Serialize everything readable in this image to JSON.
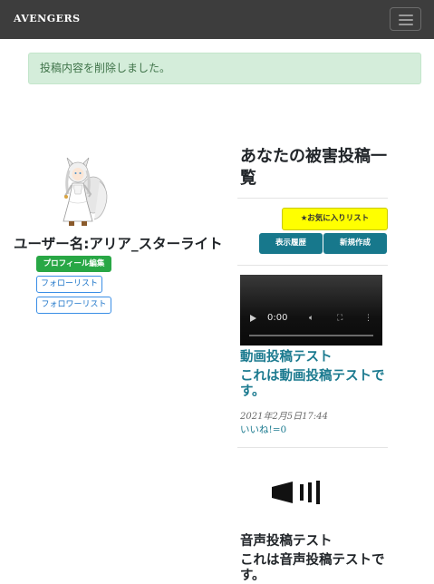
{
  "navbar": {
    "brand": "AVENGERS",
    "menu_icon": "hamburger-icon"
  },
  "alert": {
    "message": "投稿内容を削除しました。",
    "color": "#d4edda"
  },
  "profile": {
    "username": "ユーザー名:アリア_スターライト",
    "edit_label": "プロフィール編集",
    "follow_list_label": "フォローリスト",
    "follower_list_label": "フォロワーリスト"
  },
  "main": {
    "heading": "あなたの被害投稿一覧",
    "favorites_label": "★お気に入りリスト",
    "history_label": "表示履歴",
    "new_post_label": "新規作成"
  },
  "posts": [
    {
      "type": "video",
      "video_time": "0:00",
      "title": "動画投稿テスト",
      "body": "これは動画投稿テストです。",
      "date": "2021年2月5日17:44",
      "likes": "いいね!=0"
    },
    {
      "type": "audio",
      "title": "音声投稿テスト",
      "body": "これは音声投稿テストです。"
    }
  ],
  "colors": {
    "navbar": "#3d3d3d",
    "accent_teal": "#17788c",
    "success": "#28a745",
    "fav_yellow": "#ffff00"
  }
}
